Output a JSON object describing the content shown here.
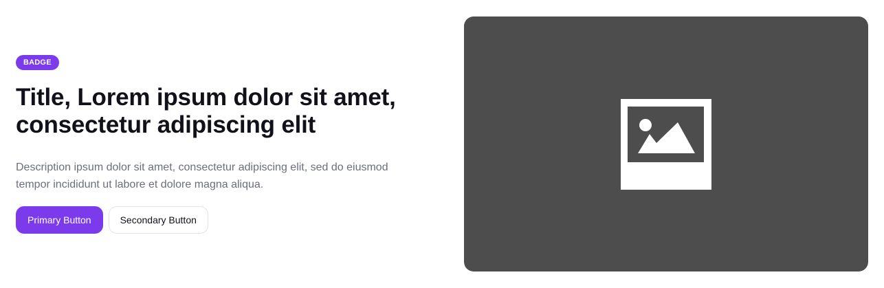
{
  "hero": {
    "badge": "BADGE",
    "title": "Title, Lorem ipsum dolor sit amet, consectetur adipiscing elit",
    "description": "Description ipsum dolor sit amet, consectetur adipiscing elit, sed do eiusmod tempor incididunt ut labore et dolore magna aliqua.",
    "primary_button": "Primary Button",
    "secondary_button": "Secondary Button"
  },
  "media": {
    "icon": "image-placeholder-icon"
  },
  "colors": {
    "accent": "#7c3aed",
    "title": "#111219",
    "description": "#6b6f7b",
    "media_background": "#4d4d4d"
  }
}
